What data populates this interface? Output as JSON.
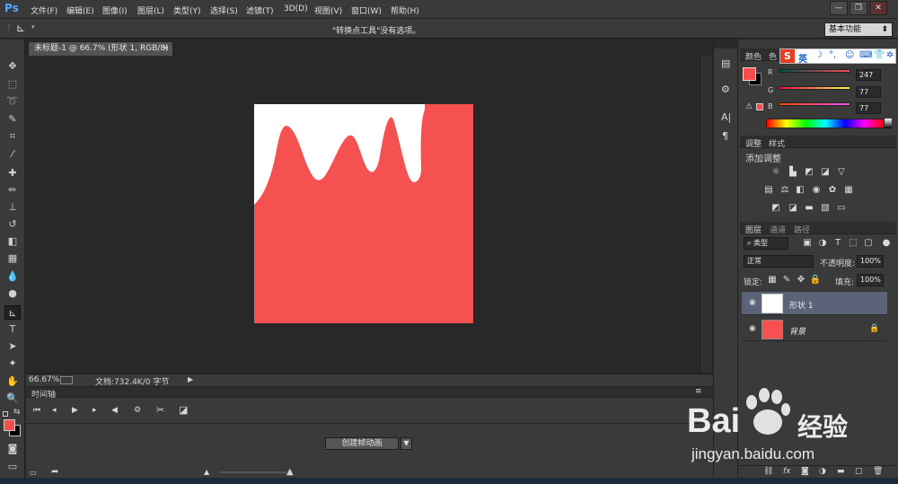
{
  "app": {
    "logo": "Ps"
  },
  "menu": [
    "文件(F)",
    "编辑(E)",
    "图像(I)",
    "图层(L)",
    "类型(Y)",
    "选择(S)",
    "滤镜(T)",
    "3D(D)",
    "视图(V)",
    "窗口(W)",
    "帮助(H)"
  ],
  "window_controls": [
    "—",
    "❐",
    "✕"
  ],
  "options_bar": {
    "message": "\"转换点工具\"没有选项。",
    "workspace": "基本功能"
  },
  "document": {
    "tab_title": "未标题-1 @ 66.7% (形状 1, RGB/8) *",
    "tab_close": "×",
    "zoom": "66.67%",
    "doc_info": "文档:732.4K/0 字节",
    "fill_color": "#f55151",
    "shape_color": "#ffffff"
  },
  "timeline": {
    "title": "时间轴",
    "create_button": "创建帧动画"
  },
  "color_panel": {
    "tab1": "颜色",
    "tab2": "色",
    "r_label": "R",
    "g_label": "G",
    "b_label": "B",
    "r": "247",
    "g": "77",
    "b": "77",
    "foreground": "#f74d4d",
    "background": "#000000"
  },
  "adjustments_panel": {
    "tab1": "调整",
    "tab2": "样式",
    "title": "添加调整"
  },
  "layers_panel": {
    "tabs": [
      "图层",
      "通道",
      "路径"
    ],
    "filter_kind": "类型",
    "blend_mode": "正常",
    "opacity_label": "不透明度:",
    "opacity": "100%",
    "lock_label": "锁定:",
    "fill_label": "填充:",
    "fill": "100%",
    "layers": [
      {
        "name": "形状 1",
        "selected": true
      },
      {
        "name": "背景",
        "selected": false
      }
    ]
  },
  "ime": {
    "logo": "S",
    "lang": "英"
  },
  "watermark": {
    "brand": "Bai",
    "brand_cn": "经验",
    "url": "jingyan.baidu.com"
  }
}
